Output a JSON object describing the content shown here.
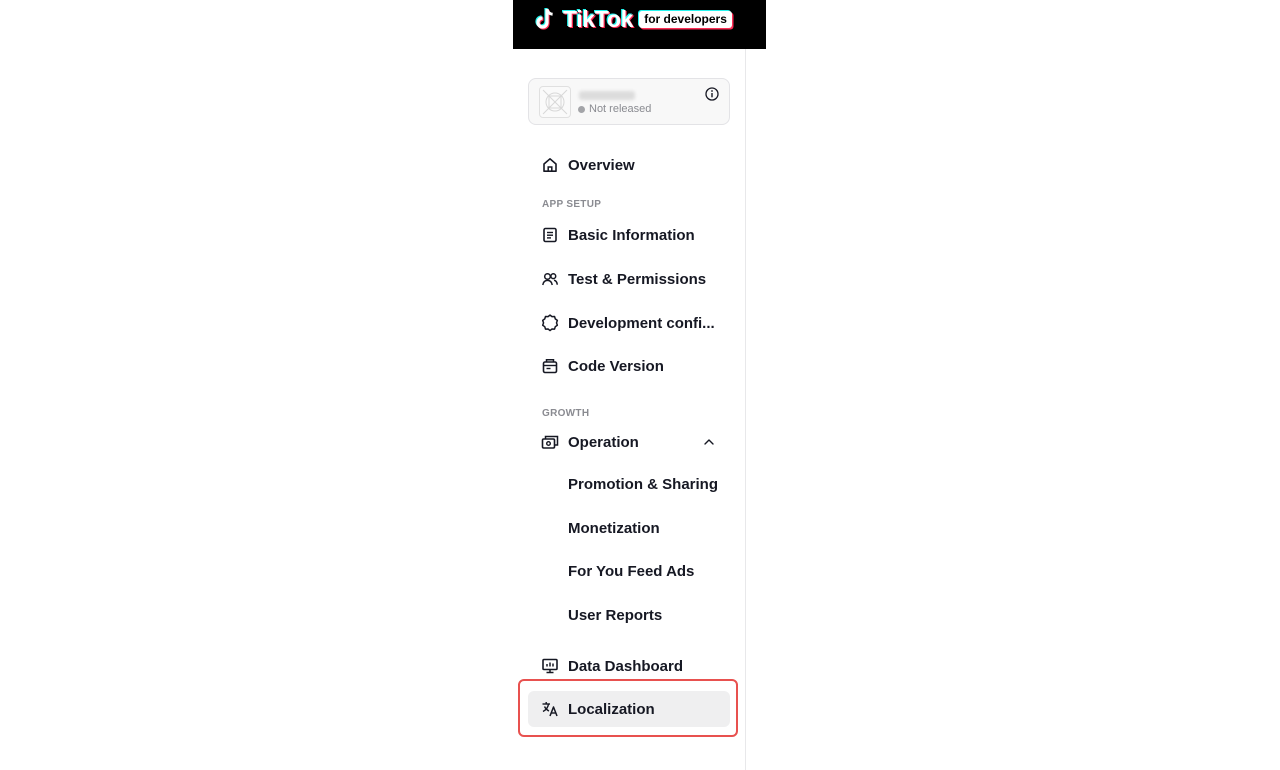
{
  "header": {
    "logo_text": "TikTok",
    "logo_badge": "for developers"
  },
  "app": {
    "status": "Not released"
  },
  "nav": {
    "overview": "Overview",
    "section_app_setup": "APP SETUP",
    "basic_information": "Basic Information",
    "test_permissions": "Test & Permissions",
    "development_config": "Development confi...",
    "code_version": "Code Version",
    "section_growth": "GROWTH",
    "operation": "Operation",
    "promotion_sharing": "Promotion & Sharing",
    "monetization": "Monetization",
    "for_you_feed_ads": "For You Feed Ads",
    "user_reports": "User Reports",
    "data_dashboard": "Data Dashboard",
    "localization": "Localization"
  },
  "colors": {
    "header_bg": "#000000",
    "highlight": "#e8514f",
    "active_bg": "#efeff0",
    "tiktok_cyan": "#25f4ee",
    "tiktok_red": "#fe2c55"
  }
}
